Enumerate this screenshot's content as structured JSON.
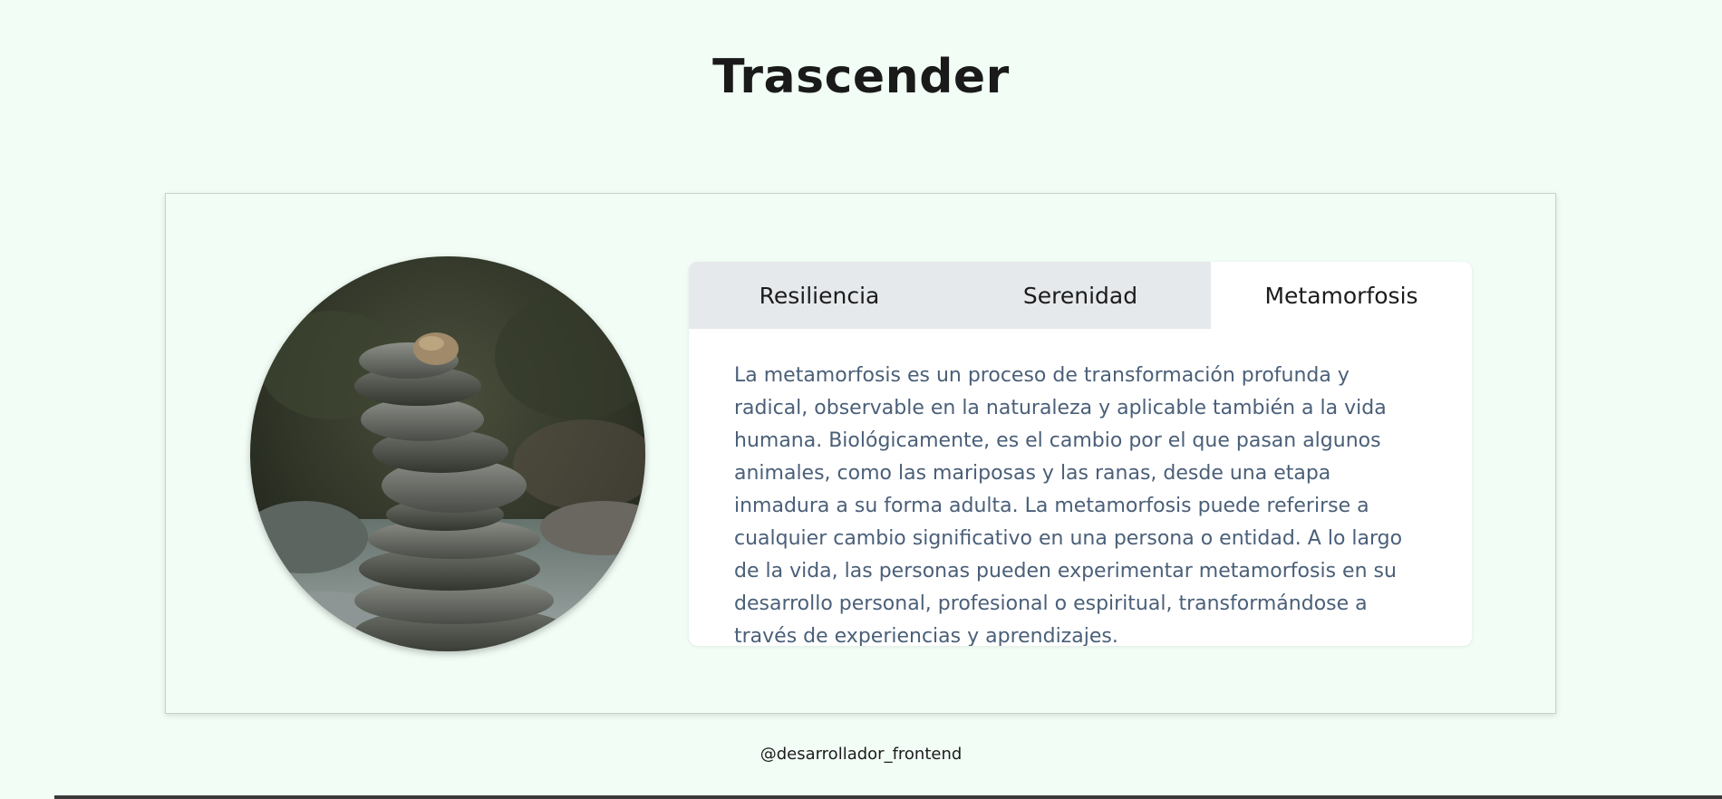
{
  "header": {
    "title": "Trascender"
  },
  "tabs": [
    {
      "label": "Resiliencia",
      "active": false
    },
    {
      "label": "Serenidad",
      "active": false
    },
    {
      "label": "Metamorfosis",
      "active": true
    }
  ],
  "content": {
    "text": "La metamorfosis es un proceso de transformación profunda y radical, observable en la naturaleza y aplicable también a la vida humana. Biológicamente, es el cambio por el que pasan algunos animales, como las mariposas y las ranas, desde una etapa inmadura a su forma adulta. La metamorfosis puede referirse a cualquier cambio significativo en una persona o entidad. A lo largo de la vida, las personas pueden experimentar metamorfosis en su desarrollo personal, profesional o espiritual, transformándose a través de experiencias y aprendizajes."
  },
  "image": {
    "subject": "stacked-stones-photo"
  },
  "footer": {
    "handle": "@desarrollador_frontend"
  },
  "colors": {
    "page_background": "#f2fdf6",
    "tab_bar_inactive": "#e6e9ec",
    "tab_active": "#ffffff",
    "body_text": "#4a5f78"
  }
}
